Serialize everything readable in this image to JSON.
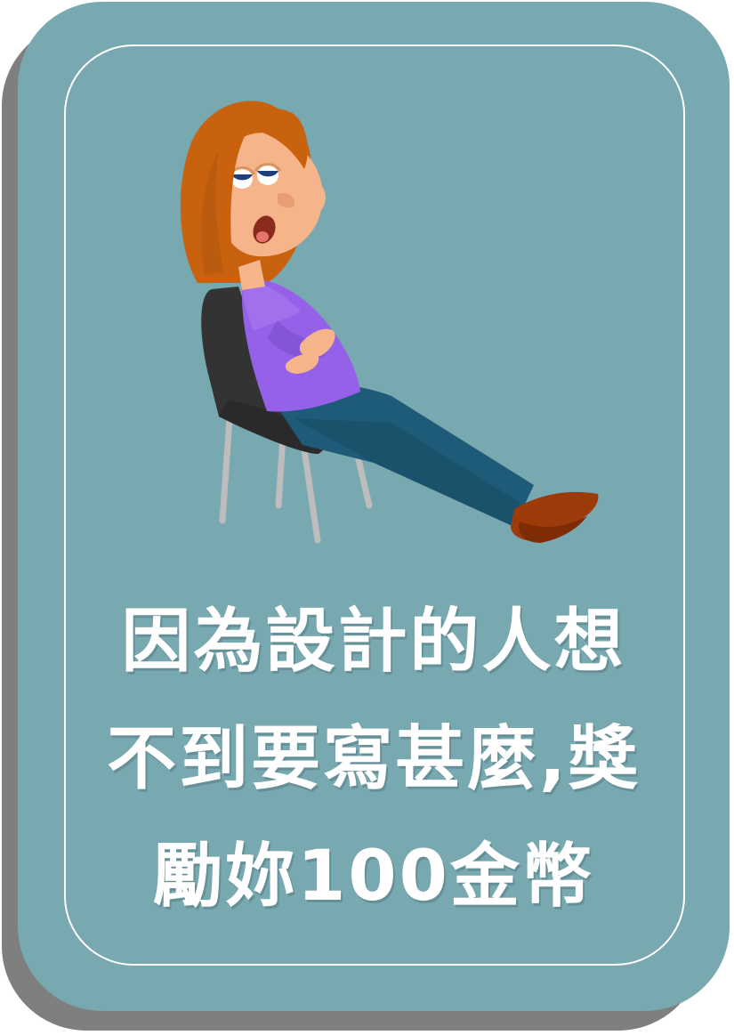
{
  "card": {
    "background_color": "#78a8b0",
    "shadow_color": "#7f7f7f",
    "border_color": "#ffffff"
  },
  "illustration": {
    "subject": "woman-sleeping-in-chair",
    "colors": {
      "hair": "#c8620f",
      "skin": "#f6b48a",
      "shirt": "#9461e8",
      "pants": "#1e5b78",
      "shoes": "#9c3a0a",
      "chair": "#333333",
      "chair_legs": "#bdbdbd"
    }
  },
  "message": {
    "line1": "因為設計的人想",
    "line2": "不到要寫甚麼,獎",
    "line3": "勵妳100金幣"
  }
}
